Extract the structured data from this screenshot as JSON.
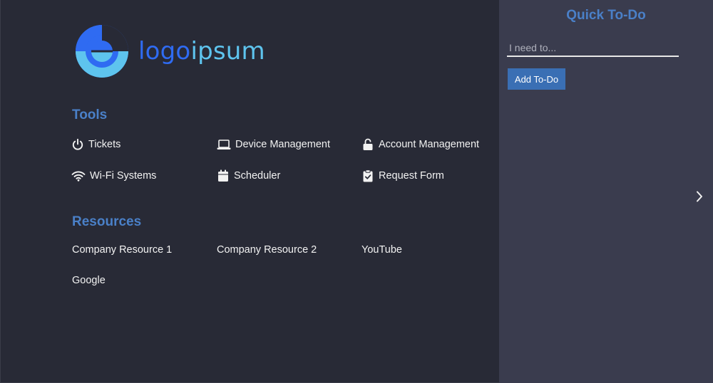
{
  "logo": {
    "part1": "logo",
    "part2": "ipsum",
    "colors": {
      "primary": "#2f6bf2",
      "secondary": "#5ec4ee"
    }
  },
  "tools": {
    "title": "Tools",
    "items": [
      {
        "label": "Tickets",
        "icon": "power-icon"
      },
      {
        "label": "Device Management",
        "icon": "laptop-icon"
      },
      {
        "label": "Account Management",
        "icon": "unlock-icon"
      },
      {
        "label": "Wi-Fi Systems",
        "icon": "wifi-icon"
      },
      {
        "label": "Scheduler",
        "icon": "calendar-icon"
      },
      {
        "label": "Request Form",
        "icon": "clipboard-check-icon"
      }
    ]
  },
  "resources": {
    "title": "Resources",
    "items": [
      {
        "label": "Company Resource 1"
      },
      {
        "label": "Company Resource 2"
      },
      {
        "label": "YouTube"
      },
      {
        "label": "Google"
      }
    ]
  },
  "todo": {
    "title": "Quick To-Do",
    "placeholder": "I need to...",
    "value": "",
    "button_label": "Add To-Do",
    "toggle_icon": "chevron-right-icon"
  },
  "colors": {
    "heading": "#4a80c8",
    "button": "#3a6fb4",
    "sidebar_bg": "#3a3c4e",
    "main_bg": "#282a36"
  }
}
